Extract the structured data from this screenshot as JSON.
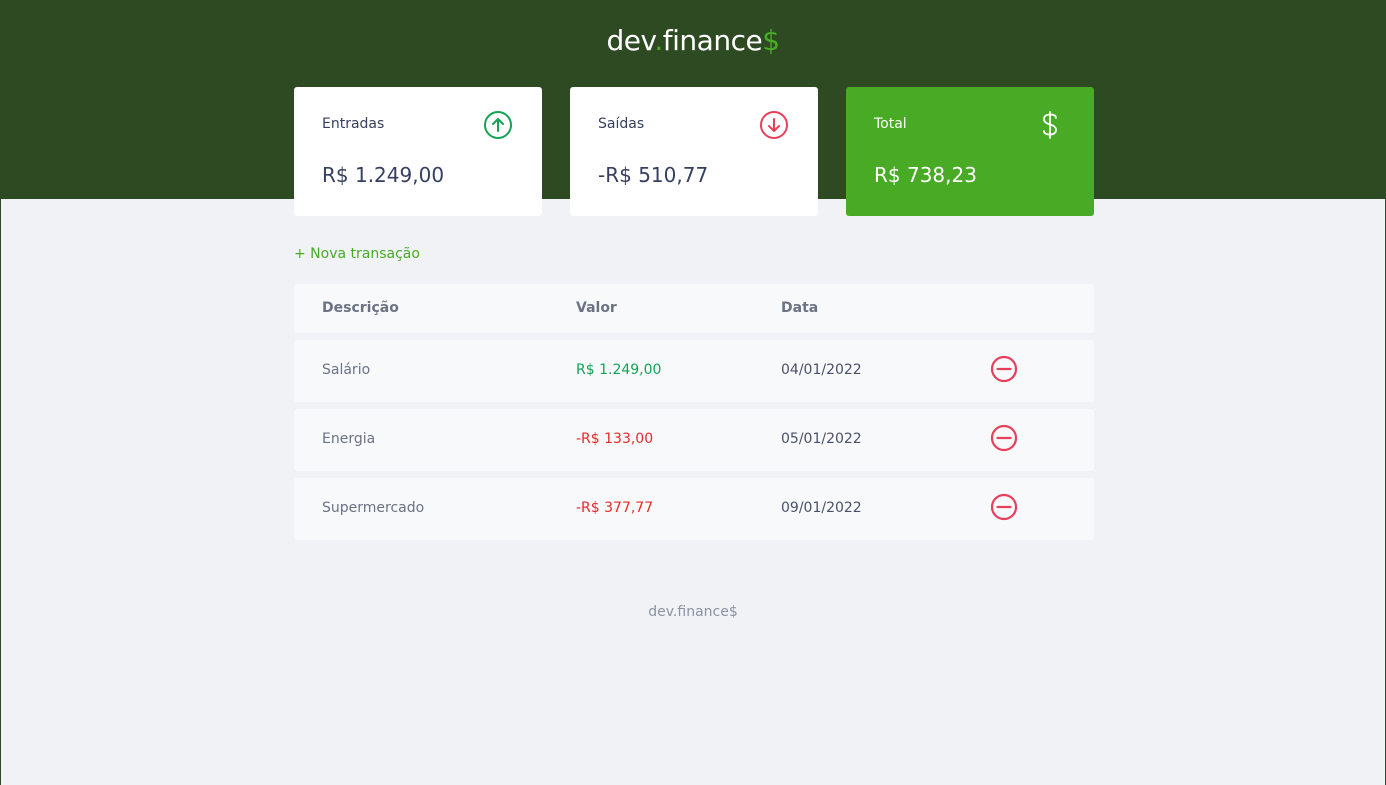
{
  "header": {
    "logo_main": "dev",
    "logo_dot": ".",
    "logo_name": "finance",
    "logo_dollar": "$"
  },
  "cards": {
    "income": {
      "label": "Entradas",
      "value": "R$ 1.249,00",
      "icon": "arrow-up-circle-icon",
      "color": "#12a454"
    },
    "expense": {
      "label": "Saídas",
      "value": "-R$ 510,77",
      "icon": "arrow-down-circle-icon",
      "color": "#e92929"
    },
    "total": {
      "label": "Total",
      "value": "R$ 738,23",
      "icon": "dollar-icon",
      "color": "#49aa26"
    }
  },
  "new_transaction_label": "+ Nova transação",
  "table": {
    "headers": {
      "description": "Descrição",
      "amount": "Valor",
      "date": "Data"
    },
    "rows": [
      {
        "description": "Salário",
        "amount": "R$ 1.249,00",
        "date": "04/01/2022",
        "type": "income"
      },
      {
        "description": "Energia",
        "amount": "-R$ 133,00",
        "date": "05/01/2022",
        "type": "expense"
      },
      {
        "description": "Supermercado",
        "amount": "-R$ 377,77",
        "date": "09/01/2022",
        "type": "expense"
      }
    ]
  },
  "footer": {
    "text": "dev.finance$"
  }
}
